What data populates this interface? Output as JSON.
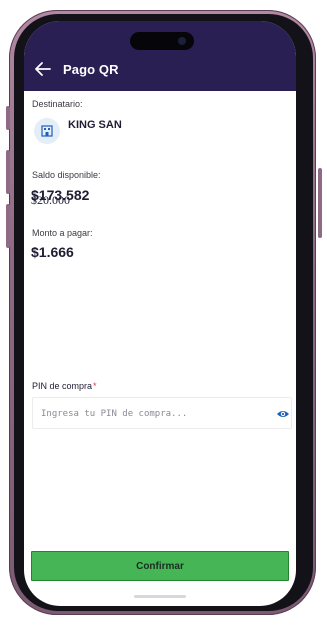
{
  "header": {
    "title": "Pago QR",
    "back_icon": "arrow-left-icon"
  },
  "recipient": {
    "label": "Destinatario:",
    "icon": "building-icon",
    "name": "KING SAN"
  },
  "balance": {
    "label": "Saldo disponible:",
    "value_overlay_a": "$173.582",
    "value_overlay_b": "$20.000"
  },
  "amount": {
    "label": "Monto a pagar:",
    "value": "$1.666"
  },
  "pin": {
    "label": "PIN de compra",
    "required_mark": "*",
    "placeholder": "Ingresa tu PIN de compra...",
    "value": "",
    "visibility_icon": "eye-icon"
  },
  "actions": {
    "confirm_label": "Confirmar"
  },
  "colors": {
    "header_bg": "#2a1f52",
    "confirm_bg": "#45b556",
    "accent_blue": "#1f5fb8",
    "required": "#e0324b"
  }
}
